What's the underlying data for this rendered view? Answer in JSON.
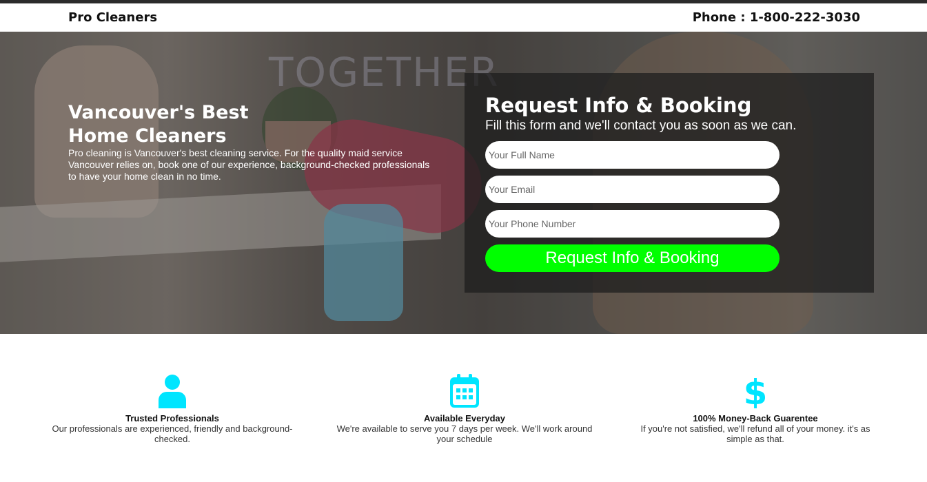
{
  "header": {
    "brand": "Pro Cleaners",
    "phone": "Phone : 1-800-222-3030"
  },
  "hero": {
    "title": "Vancouver's Best Home Cleaners",
    "text": "Pro cleaning is Vancouver's best cleaning service. For the quality maid service Vancouver relies on, book one of our experience, background-checked professionals to have your home clean in no time.",
    "neon_sign": "TOGETHER"
  },
  "form": {
    "title": "Request Info & Booking",
    "subtitle": "Fill this form and we'll contact you as soon as we can.",
    "name_placeholder": "Your Full Name",
    "email_placeholder": "Your Email",
    "phone_placeholder": "Your Phone Number",
    "submit_label": "Request Info & Booking",
    "accent_color": "#00ff00"
  },
  "features": [
    {
      "icon": "user-icon",
      "title": "Trusted Professionals",
      "text": "Our professionals are experienced, friendly and background-checked."
    },
    {
      "icon": "calendar-icon",
      "title": "Available Everyday",
      "text": "We're available to serve you 7 days per week. We'll work around your schedule"
    },
    {
      "icon": "dollar-icon",
      "title": "100% Money-Back Guarentee",
      "text": "If you're not satisfied, we'll refund all of your money. it's as simple as that."
    }
  ],
  "icon_color": "#00e5ff"
}
